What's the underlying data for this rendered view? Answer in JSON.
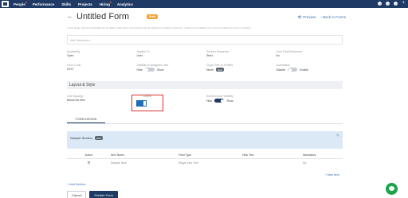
{
  "nav": {
    "items": [
      "People",
      "Performance",
      "Skills",
      "Projects",
      "Hiring",
      "Analytics"
    ]
  },
  "header": {
    "title": "Untitled Form",
    "badge": "Draft",
    "preview": "Preview",
    "back": "Back to Forms",
    "subtitle": "In this stage, sections and fields can be added. New forms and sections can be added for pending to the form. It will not be available yet in the form library for users to access."
  },
  "description_placeholder": "Add Description...",
  "fields": [
    {
      "label": "Availability",
      "value": "Open"
    },
    {
      "label": "Applies To",
      "value": "User"
    },
    {
      "label": "Section Sequence",
      "value": "Strict"
    },
    {
      "label": "Limit Final Response",
      "value": "No"
    },
    {
      "label": "Form Code",
      "value": "UF47"
    },
    {
      "label": "Visibility to Assigned User",
      "value_left": "Hide",
      "value_right": "Show"
    },
    {
      "label": "Copy Over to Profiles",
      "value": "Never",
      "badge": "Beta"
    },
    {
      "label": "Automation",
      "value_left": "Disable",
      "value_right": "Enable"
    }
  ],
  "layout_style": {
    "header": "Layout & Style",
    "line_spacing_label": "Line Spacing",
    "line_spacing_value": "Below the Item",
    "layout_label": "Layout",
    "visibility_label": "Section Most Visibility",
    "visibility_left": "Hide",
    "visibility_right": "Show"
  },
  "tabs": {
    "active": "FORM DESIGN"
  },
  "section": {
    "name": "Sample Section",
    "badge": "New",
    "columns": [
      "Action",
      "Item Name",
      "Field Type",
      "Help Text",
      "Mandatory"
    ],
    "rows": [
      {
        "action": "🗑",
        "item_name": "Sample Item",
        "field_type": "Single Line Text",
        "help_text": "",
        "mandatory": "No"
      }
    ],
    "new_item": "+ New Item"
  },
  "add_section": "+ Add Section",
  "footer": {
    "cancel": "Cancel",
    "publish": "Publish Form"
  },
  "colors": {
    "nav_bg": "#1f3a64",
    "accent": "#1f6fb8",
    "highlight": "#d9342b",
    "draft": "#f2a33a",
    "chat": "#1fa34a"
  }
}
